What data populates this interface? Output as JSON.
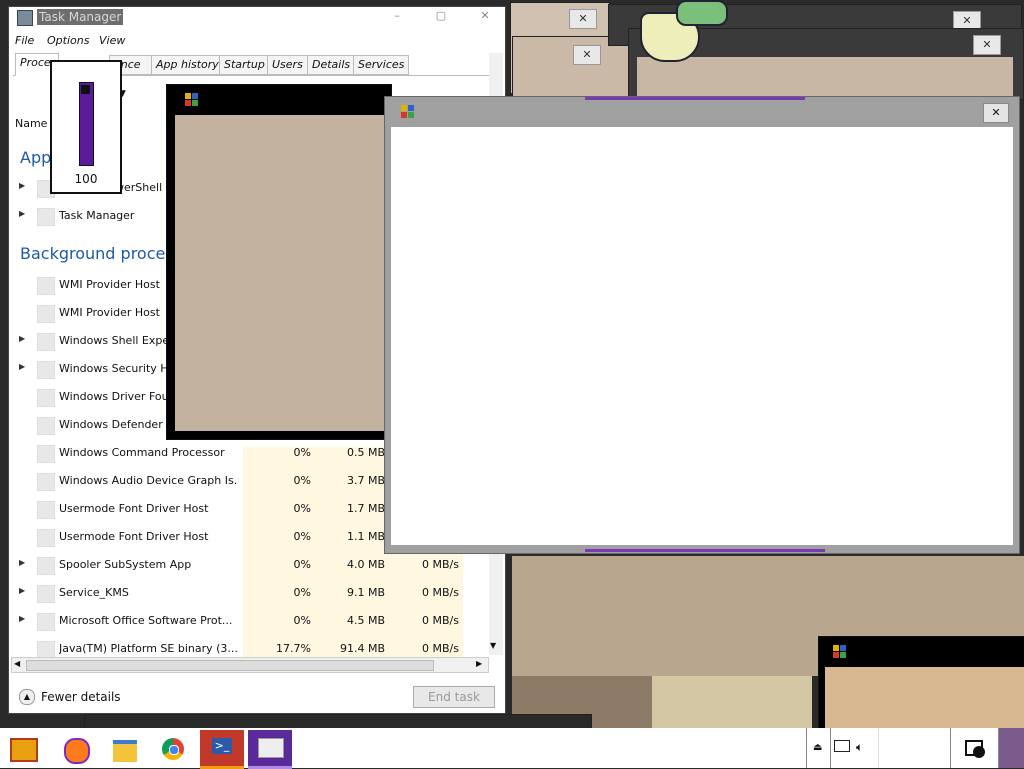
{
  "task_manager": {
    "title": "Task Manager",
    "menu": [
      "File",
      "Options",
      "View"
    ],
    "tabs": [
      "Processes",
      "Performance",
      "App history",
      "Startup",
      "Users",
      "Details",
      "Services"
    ],
    "tab_visible": [
      "Proces",
      "ance",
      "App history",
      "Startup",
      "Users",
      "Details",
      "Services"
    ],
    "column_name": "Name",
    "group_apps": "Apps",
    "group_background": "Background processes",
    "apps": [
      {
        "name": "Windows PowerShell",
        "visible": "werShell",
        "expandable": true
      },
      {
        "name": "Task Manager",
        "visible": "Task Manager",
        "expandable": true
      }
    ],
    "processes": [
      {
        "name": "WMI Provider Host",
        "cpu": "",
        "mem": "",
        "disk": "",
        "expandable": false
      },
      {
        "name": "WMI Provider Host",
        "cpu": "",
        "mem": "",
        "disk": "",
        "expandable": false
      },
      {
        "name": "Windows Shell Exper",
        "cpu": "",
        "mem": "",
        "disk": "",
        "expandable": true
      },
      {
        "name": "Windows Security He",
        "cpu": "",
        "mem": "",
        "disk": "",
        "expandable": true
      },
      {
        "name": "Windows Driver Foun",
        "cpu": "",
        "mem": "",
        "disk": "",
        "expandable": false
      },
      {
        "name": "Windows Defender S",
        "cpu": "",
        "mem": "",
        "disk": "",
        "expandable": false
      },
      {
        "name": "Windows Command Processor",
        "cpu": "0%",
        "mem": "0.5 MB",
        "disk": "",
        "expandable": false
      },
      {
        "name": "Windows Audio Device Graph Is...",
        "cpu": "0%",
        "mem": "3.7 MB",
        "disk": "",
        "expandable": false
      },
      {
        "name": "Usermode Font Driver Host",
        "cpu": "0%",
        "mem": "1.7 MB",
        "disk": "",
        "expandable": false
      },
      {
        "name": "Usermode Font Driver Host",
        "cpu": "0%",
        "mem": "1.1 MB",
        "disk": "",
        "expandable": false
      },
      {
        "name": "Spooler SubSystem App",
        "cpu": "0%",
        "mem": "4.0 MB",
        "disk": "0 MB/s",
        "expandable": true
      },
      {
        "name": "Service_KMS",
        "cpu": "0%",
        "mem": "9.1 MB",
        "disk": "0 MB/s",
        "expandable": true
      },
      {
        "name": "Microsoft Office Software Prot...",
        "cpu": "0%",
        "mem": "4.5 MB",
        "disk": "0 MB/s",
        "expandable": true
      },
      {
        "name": "Java(TM) Platform SE binary (3...",
        "cpu": "17.7%",
        "mem": "91.4 MB",
        "disk": "0 MB/s",
        "expandable": false
      }
    ],
    "fewer_details": "Fewer details",
    "end_task": "End task"
  },
  "level_widget": {
    "value_label": "100",
    "level": 1.0,
    "fill_color": "#5b1c9c"
  },
  "colors": {
    "accent_purple": "#7a3ab8",
    "group_blue": "#1e5aa8"
  },
  "taskbar": {
    "icons": [
      "start-icon",
      "firefox-icon",
      "file-explorer-icon",
      "chrome-icon",
      "powershell-icon",
      "task-manager-icon"
    ],
    "tray": [
      "eject-icon",
      "network-icon",
      "volume-icon",
      "notification-icon"
    ]
  }
}
